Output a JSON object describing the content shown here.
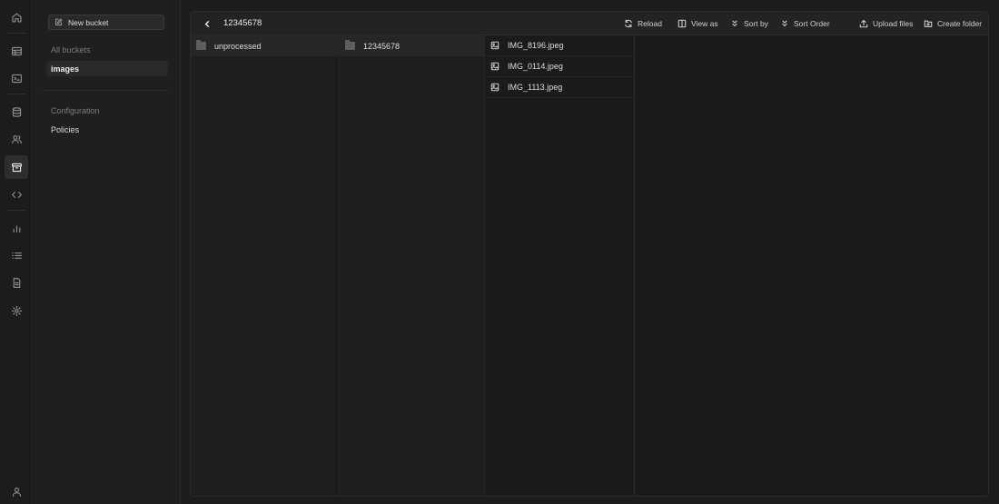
{
  "rail": {
    "items": [
      {
        "icon": "home-icon"
      },
      {
        "icon": "table-icon"
      },
      {
        "icon": "terminal-icon"
      },
      {
        "icon": "database-icon"
      },
      {
        "icon": "users-icon"
      },
      {
        "icon": "storage-icon",
        "active": true
      },
      {
        "icon": "code-icon"
      },
      {
        "icon": "reports-icon"
      },
      {
        "icon": "logs-icon"
      },
      {
        "icon": "docs-icon"
      },
      {
        "icon": "settings-icon"
      },
      {
        "icon": "profile-icon"
      }
    ]
  },
  "sidebar": {
    "new_bucket_label": "New bucket",
    "all_buckets_label": "All buckets",
    "buckets": [
      "images"
    ],
    "configuration_label": "Configuration",
    "config_items": [
      "Policies"
    ]
  },
  "explorer": {
    "breadcrumb": "12345678",
    "toolbar": {
      "reload": "Reload",
      "view_as": "View as",
      "sort_by": "Sort by",
      "sort_order": "Sort Order",
      "upload_files": "Upload files",
      "create_folder": "Create folder"
    },
    "columns": [
      {
        "items": [
          {
            "name": "unprocessed",
            "type": "folder"
          }
        ]
      },
      {
        "items": [
          {
            "name": "12345678",
            "type": "folder"
          }
        ]
      },
      {
        "items": [
          {
            "name": "IMG_8196.jpeg",
            "type": "image"
          },
          {
            "name": "IMG_0114.jpeg",
            "type": "image"
          },
          {
            "name": "IMG_1113.jpeg",
            "type": "image"
          }
        ]
      }
    ]
  },
  "colors": {
    "background": "#1c1c1c",
    "panel": "#1f1f1f",
    "toolbar": "#232323",
    "text": "#ededed",
    "muted": "#7c7c7c"
  }
}
